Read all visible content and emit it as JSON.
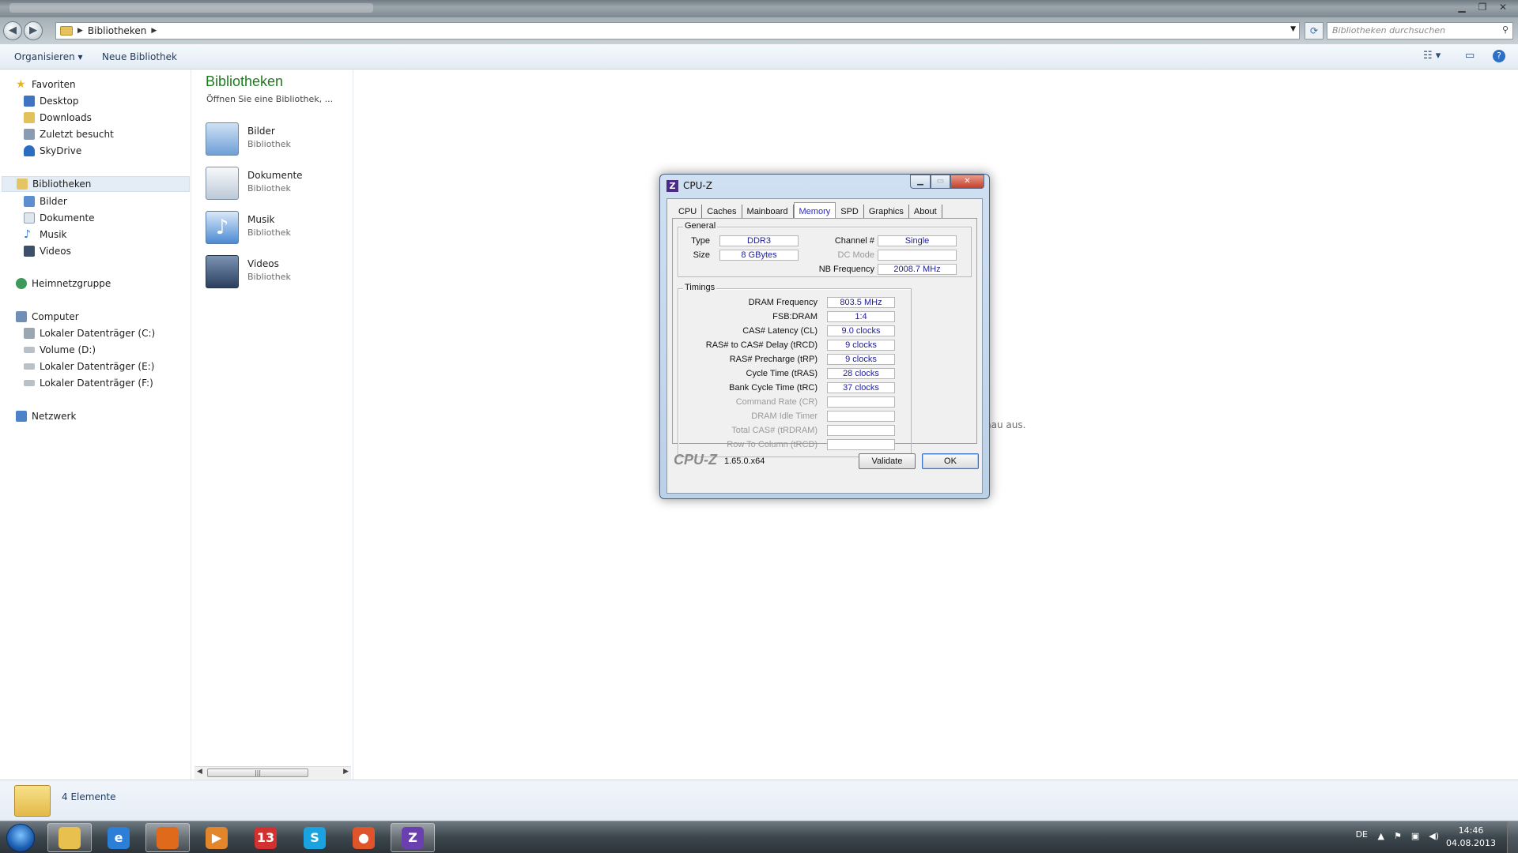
{
  "explorer": {
    "address": {
      "crumb": "Bibliotheken"
    },
    "search_placeholder": "Bibliotheken durchsuchen",
    "toolbar": {
      "organize": "Organisieren",
      "new_library": "Neue Bibliothek"
    },
    "nav": {
      "favorites": {
        "label": "Favoriten",
        "items": [
          "Desktop",
          "Downloads",
          "Zuletzt besucht",
          "SkyDrive"
        ]
      },
      "libraries": {
        "label": "Bibliotheken",
        "items": [
          "Bilder",
          "Dokumente",
          "Musik",
          "Videos"
        ]
      },
      "homegroup": "Heimnetzgruppe",
      "computer": {
        "label": "Computer",
        "items": [
          "Lokaler Datenträger (C:)",
          "Volume (D:)",
          "Lokaler Datenträger (E:)",
          "Lokaler Datenträger (F:)"
        ]
      },
      "network": "Netzwerk"
    },
    "library_pane": {
      "title": "Bibliotheken",
      "subtitle": "Öffnen Sie eine Bibliothek, ...",
      "items": [
        {
          "name": "Bilder",
          "type": "Bibliothek"
        },
        {
          "name": "Dokumente",
          "type": "Bibliothek"
        },
        {
          "name": "Musik",
          "type": "Bibliothek"
        },
        {
          "name": "Videos",
          "type": "Bibliothek"
        }
      ]
    },
    "partial_message": "hau aus.",
    "status": {
      "count": "4 Elemente"
    }
  },
  "cpuz": {
    "title": "CPU-Z",
    "tabs": [
      "CPU",
      "Caches",
      "Mainboard",
      "Memory",
      "SPD",
      "Graphics",
      "About"
    ],
    "active_tab": "Memory",
    "general": {
      "legend": "General",
      "type_label": "Type",
      "type_value": "DDR3",
      "size_label": "Size",
      "size_value": "8 GBytes",
      "channel_label": "Channel #",
      "channel_value": "Single",
      "dc_label": "DC Mode",
      "dc_value": "",
      "nb_label": "NB Frequency",
      "nb_value": "2008.7 MHz"
    },
    "timings": {
      "legend": "Timings",
      "rows": [
        {
          "label": "DRAM Frequency",
          "value": "803.5 MHz",
          "dim": false
        },
        {
          "label": "FSB:DRAM",
          "value": "1:4",
          "dim": false
        },
        {
          "label": "CAS# Latency (CL)",
          "value": "9.0 clocks",
          "dim": false
        },
        {
          "label": "RAS# to CAS# Delay (tRCD)",
          "value": "9 clocks",
          "dim": false
        },
        {
          "label": "RAS# Precharge (tRP)",
          "value": "9 clocks",
          "dim": false
        },
        {
          "label": "Cycle Time (tRAS)",
          "value": "28 clocks",
          "dim": false
        },
        {
          "label": "Bank Cycle Time (tRC)",
          "value": "37 clocks",
          "dim": false
        },
        {
          "label": "Command Rate (CR)",
          "value": "",
          "dim": true
        },
        {
          "label": "DRAM Idle Timer",
          "value": "",
          "dim": true
        },
        {
          "label": "Total CAS# (tRDRAM)",
          "value": "",
          "dim": true
        },
        {
          "label": "Row To Column (tRCD)",
          "value": "",
          "dim": true
        }
      ]
    },
    "brand": "CPU-Z",
    "version": "1.65.0.x64",
    "validate_label": "Validate",
    "ok_label": "OK"
  },
  "taskbar": {
    "lang": "DE",
    "time": "14:46",
    "date": "04.08.2013",
    "apps": [
      {
        "name": "explorer",
        "glyph": "",
        "color": "#e8c04e",
        "active": true
      },
      {
        "name": "internet-explorer",
        "glyph": "e",
        "color": "#2b7fd6",
        "active": false
      },
      {
        "name": "firefox",
        "glyph": "",
        "color": "#e06a1b",
        "active": true
      },
      {
        "name": "media-player",
        "glyph": "▶",
        "color": "#e2852b",
        "active": false
      },
      {
        "name": "app-13",
        "glyph": "13",
        "color": "#d33030",
        "active": false
      },
      {
        "name": "skype",
        "glyph": "S",
        "color": "#1aa3e0",
        "active": false
      },
      {
        "name": "record-app",
        "glyph": "●",
        "color": "#e0542b",
        "active": false
      },
      {
        "name": "cpuz-app",
        "glyph": "Z",
        "color": "#6a3fb0",
        "active": true
      }
    ]
  }
}
